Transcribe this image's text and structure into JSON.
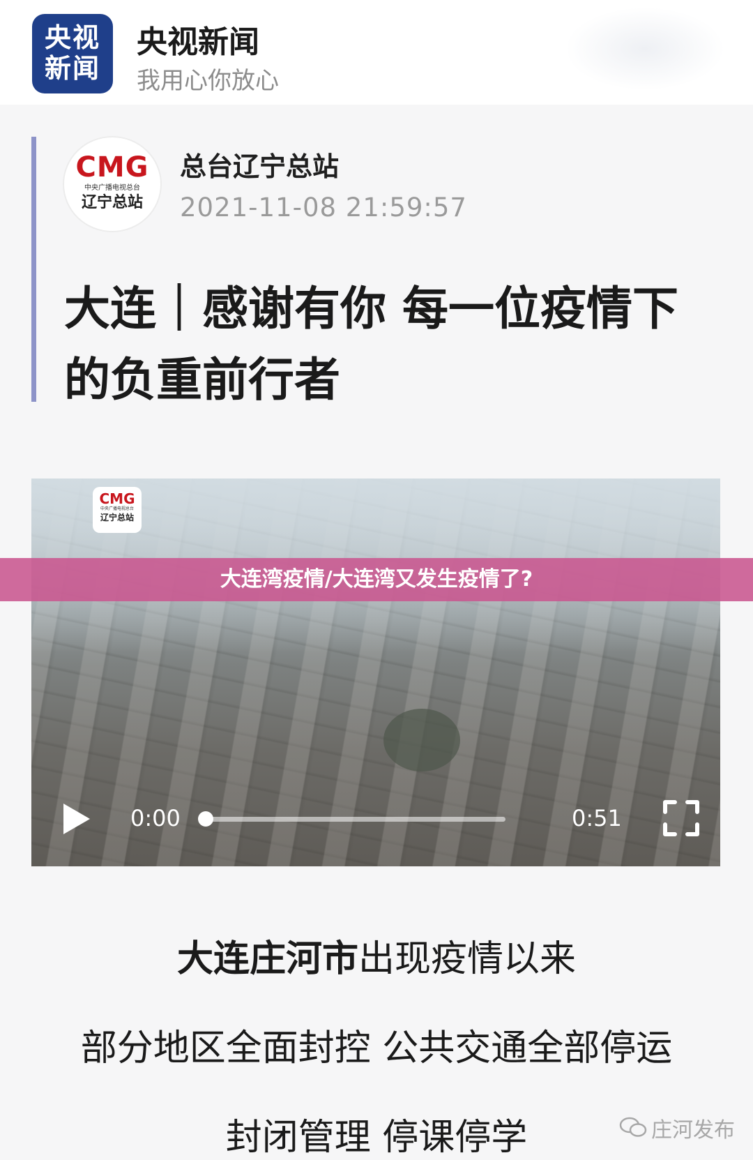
{
  "app": {
    "logo_line1": "央视",
    "logo_line2": "新闻",
    "name": "央视新闻",
    "slogan": "我用心你放心"
  },
  "author": {
    "avatar_brand": "CMG",
    "avatar_cn": "中央广播电视总台",
    "avatar_station": "辽宁总站",
    "name": "总台辽宁总站",
    "time": "2021-11-08 21:59:57"
  },
  "article": {
    "title": "大连｜感谢有你 每一位疫情下的负重前行者"
  },
  "video": {
    "badge_brand": "CMG",
    "badge_cn": "中央广播电视总台",
    "badge_station": "辽宁总站",
    "current_time": "0:00",
    "total_time": "0:51",
    "progress": 0
  },
  "overlay": {
    "text": "大连湾疫情/大连湾又发生疫情了?"
  },
  "body": {
    "line1_strong": "大连庄河市",
    "line1_rest": "出现疫情以来",
    "line2": "部分地区全面封控 公共交通全部停运",
    "line3": "封闭管理 停课停学"
  },
  "watermark": {
    "text": "庄河发布"
  }
}
